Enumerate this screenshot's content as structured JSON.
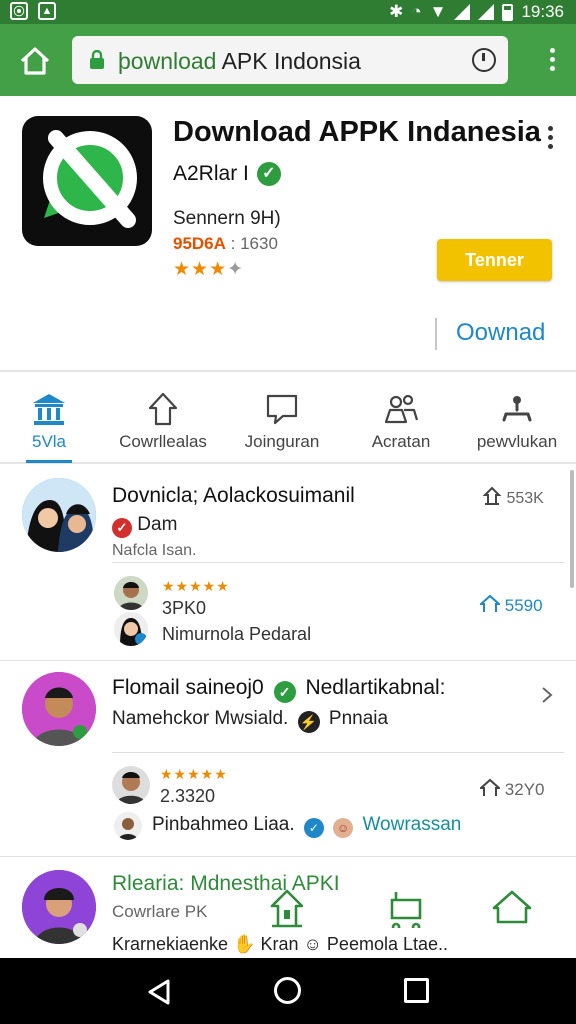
{
  "status_bar": {
    "time": "19:36"
  },
  "browser": {
    "url_prefix": "þownload",
    "url_rest": " APK Indonsia"
  },
  "app": {
    "title": "Download APPK Indanesia",
    "developer": "A2Rlar I",
    "subtitle": "Sennern 9H)",
    "meta_prefix": "95D6A",
    "meta_rest": " : 1630",
    "rating_stars": 3,
    "install_label": "Tenner",
    "download_label": "Oownad"
  },
  "tabs": [
    {
      "label": "5Vla",
      "icon": "bank-icon",
      "active": true
    },
    {
      "label": "Cowrllealas",
      "icon": "pin-icon",
      "active": false
    },
    {
      "label": "Joinguran",
      "icon": "chat-icon",
      "active": false
    },
    {
      "label": "Acratan",
      "icon": "people-icon",
      "active": false
    },
    {
      "label": "pewvlukan",
      "icon": "hanger-icon",
      "active": false
    }
  ],
  "posts": [
    {
      "title": "Dovnicla; Aolackosuimanil",
      "badge_text": "Dam",
      "caption": "Nafcla Isan.",
      "count": "553K",
      "sub": {
        "stars": 5,
        "value": "3PK0",
        "name": "Nimurnola Pedaral",
        "count": "5590"
      }
    },
    {
      "title_part1": "Flomail saineoj0",
      "title_part2": "Nedlartikabnal:",
      "line_part1": "Namehckor Mwsiald.",
      "line_part2": "Pnnaia",
      "sub": {
        "stars": 5,
        "value": "2.3320",
        "name": "Pinbahmeo Liaa.",
        "tag": "Wowrassan",
        "count": "32Y0"
      }
    },
    {
      "title": "Rlearia: Mdnesthai APKI",
      "caption": "Cowrlare PK",
      "line_part1": "Krarnekiaenke",
      "line_part2": "Kran",
      "line_part3": "Peemola Ltae.."
    }
  ],
  "colors": {
    "status": "#2e7d32",
    "toolbar": "#43a047",
    "accent": "#1e88c8",
    "install": "#f2c200"
  }
}
